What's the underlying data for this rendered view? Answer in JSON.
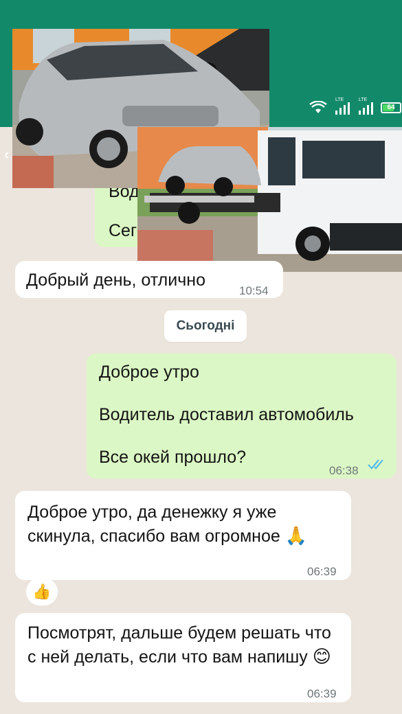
{
  "status_bar": {
    "network_1": "LTE",
    "network_2": "LTE",
    "battery": "64"
  },
  "chat": {
    "earlier_outgoing": {
      "partial_line_1": "Вод",
      "partial_line_2": "Сег"
    },
    "incoming_1": {
      "text": "Добрый день, отлично",
      "time": "10:54"
    },
    "date_separator": "Сьогодні",
    "outgoing_1": {
      "text": "Доброе утро\n\nВодитель доставил автомобиль\n\nВсе окей прошло?",
      "time": "06:38",
      "status": "read"
    },
    "incoming_2": {
      "text": "Доброе утро, да денежку я уже скинула, спасибо вам огромное",
      "emoji": "🙏",
      "time": "06:39"
    },
    "reaction": "👍",
    "incoming_3": {
      "text": "Посмотрят,  дальше будем решать что с ней делать, если что вам напишу",
      "emoji": "😊",
      "time": "06:39"
    }
  },
  "colors": {
    "header": "#128a6a",
    "wallpaper": "#ece5dd",
    "outgoing_bubble": "#dbf7c5",
    "incoming_bubble": "#ffffff",
    "read_ticks": "#53bdeb"
  },
  "icons": {
    "wifi": "wifi-icon",
    "signal": "signal-icon",
    "battery": "battery-icon",
    "back": "back-arrow-icon",
    "read_receipt": "double-check-icon"
  }
}
